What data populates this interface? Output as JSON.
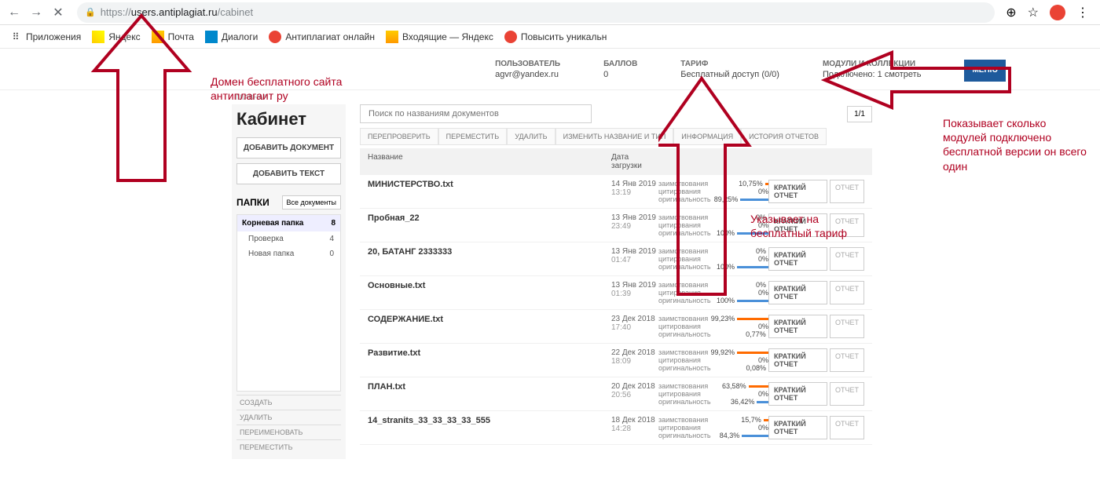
{
  "browser": {
    "url_prefix": "https://",
    "url_host": "users.antiplagiat.ru",
    "url_path": "/cabinet"
  },
  "bookmarks": {
    "apps": "Приложения",
    "yandex": "Яндекс",
    "mail": "Почта",
    "dialogs": "Диалоги",
    "ap_online": "Антиплагиат онлайн",
    "inbox": "Входящие — Яндекс",
    "uniq": "Повысить уникальн"
  },
  "header": {
    "user_label": "ПОЛЬЗОВАТЕЛЬ",
    "user_value": "agvr@yandex.ru",
    "balls_label": "БАЛЛОВ",
    "balls_value": "0",
    "tariff_label": "ТАРИФ",
    "tariff_value": "Бесплатный доступ (0/0)",
    "modules_label": "МОДУЛИ И КОЛЛЕКЦИИ",
    "modules_value": "Подключено: 1 смотреть",
    "menu": "МЕНЮ"
  },
  "breadcrumb": "ГЛАВНАЯ /",
  "sidebar": {
    "title": "Кабинет",
    "add_doc": "ДОБАВИТЬ ДОКУМЕНТ",
    "add_text": "ДОБАВИТЬ ТЕКСТ",
    "folders_label": "ПАПКИ",
    "all_docs": "Все документы",
    "root": {
      "name": "Корневая папка",
      "count": "8"
    },
    "items": [
      {
        "name": "Проверка",
        "count": "4"
      },
      {
        "name": "Новая папка",
        "count": "0"
      }
    ],
    "actions": {
      "create": "СОЗДАТЬ",
      "delete": "УДАЛИТЬ",
      "rename": "ПЕРЕИМЕНОВАТЬ",
      "move": "ПЕРЕМЕСТИТЬ"
    }
  },
  "content": {
    "search_placeholder": "Поиск по названиям документов",
    "page_indicator": "1/1",
    "toolbar": {
      "recheck": "ПЕРЕПРОВЕРИТЬ",
      "move": "ПЕРЕМЕСТИТЬ",
      "delete": "УДАЛИТЬ",
      "rename": "ИЗМЕНИТЬ НАЗВАНИЕ И ТИП",
      "info": "ИНФОРМАЦИЯ",
      "history": "ИСТОРИЯ ОТЧЕТОВ"
    },
    "thead": {
      "name": "Название",
      "date": "Дата загрузки"
    },
    "stat_labels": {
      "borrow": "заимствования",
      "cite": "цитирования",
      "orig": "оригинальность"
    },
    "report_labels": {
      "short": "КРАТКИЙ ОТЧЕТ",
      "full": "ОТЧЕТ"
    },
    "rows": [
      {
        "name": "МИНИСТЕРСТВО.txt",
        "date": "14 Янв 2019",
        "time": "13:19",
        "borrow": "10,75%",
        "cite": "0%",
        "orig": "89,25%"
      },
      {
        "name": "Пробная_22",
        "date": "13 Янв 2019",
        "time": "23:49",
        "borrow": "0%",
        "cite": "0%",
        "orig": "100%"
      },
      {
        "name": "20, БАТАНГ 2333333",
        "date": "13 Янв 2019",
        "time": "01:47",
        "borrow": "0%",
        "cite": "0%",
        "orig": "100%"
      },
      {
        "name": "Основные.txt",
        "date": "13 Янв 2019",
        "time": "01:39",
        "borrow": "0%",
        "cite": "0%",
        "orig": "100%"
      },
      {
        "name": "СОДЕРЖАНИЕ.txt",
        "date": "23 Дек 2018",
        "time": "17:40",
        "borrow": "99,23%",
        "cite": "0%",
        "orig": "0,77%"
      },
      {
        "name": "Развитие.txt",
        "date": "22 Дек 2018",
        "time": "18:09",
        "borrow": "99,92%",
        "cite": "0%",
        "orig": "0,08%"
      },
      {
        "name": "ПЛАН.txt",
        "date": "20 Дек 2018",
        "time": "20:56",
        "borrow": "63,58%",
        "cite": "0%",
        "orig": "36,42%"
      },
      {
        "name": "14_stranits_33_33_33_33_555",
        "date": "18 Дек 2018",
        "time": "14:28",
        "borrow": "15,7%",
        "cite": "0%",
        "orig": "84,3%"
      }
    ]
  },
  "annotations": {
    "domain": "Домен бесплатного сайта антиплагаит ру",
    "tariff": "Указывает на бесплатный тариф",
    "modules": "Показывает сколько модулей подключено бесплатной версии он всего один"
  }
}
